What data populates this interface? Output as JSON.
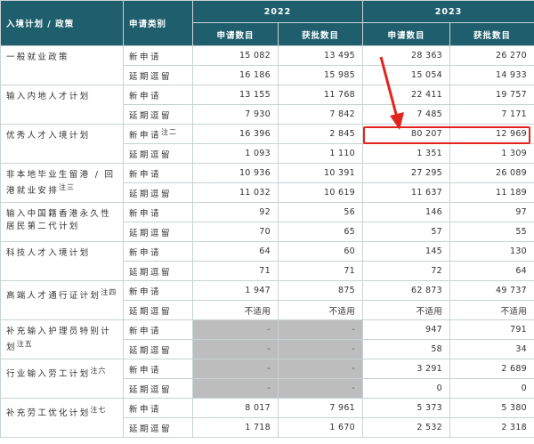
{
  "header": {
    "program": "入境计划 / 政策",
    "type": "申请类别",
    "years": [
      "2022",
      "2023"
    ],
    "cols": [
      "申请数目",
      "获批数目",
      "申请数目",
      "获批数目"
    ]
  },
  "groups": [
    {
      "name": "一般就业政策",
      "note": "",
      "rows": [
        {
          "type": "新申请",
          "v": [
            "15 082",
            "13 495",
            "28 363",
            "26 270"
          ]
        },
        {
          "type": "延期逗留",
          "v": [
            "16 186",
            "15 985",
            "15 054",
            "14 933"
          ]
        }
      ]
    },
    {
      "name": "输入内地人才计划",
      "note": "",
      "rows": [
        {
          "type": "新申请",
          "v": [
            "13 155",
            "11 768",
            "22 411",
            "19 757"
          ]
        },
        {
          "type": "延期逗留",
          "v": [
            "7 930",
            "7 842",
            "7 485",
            "7 171"
          ]
        }
      ]
    },
    {
      "name": "优秀人才入境计划",
      "note": "",
      "rows": [
        {
          "type": "新申请",
          "note": "注二",
          "v": [
            "16 396",
            "2 845",
            "80 207",
            "12 969"
          ]
        },
        {
          "type": "延期逗留",
          "v": [
            "1 093",
            "1 110",
            "1 351",
            "1 309"
          ]
        }
      ]
    },
    {
      "name": "非本地毕业生留港 / 回港就业安排",
      "note": "注三",
      "rows": [
        {
          "type": "新申请",
          "v": [
            "10 936",
            "10 391",
            "27 295",
            "26 089"
          ]
        },
        {
          "type": "延期逗留",
          "v": [
            "11 032",
            "10 619",
            "11 637",
            "11 189"
          ]
        }
      ]
    },
    {
      "name": "输入中国籍香港永久性居民第二代计划",
      "note": "",
      "rows": [
        {
          "type": "新申请",
          "v": [
            "92",
            "56",
            "146",
            "97"
          ]
        },
        {
          "type": "延期逗留",
          "v": [
            "70",
            "65",
            "57",
            "55"
          ]
        }
      ]
    },
    {
      "name": "科技人才入境计划",
      "note": "",
      "rows": [
        {
          "type": "新申请",
          "v": [
            "64",
            "60",
            "145",
            "130"
          ]
        },
        {
          "type": "延期逗留",
          "v": [
            "71",
            "71",
            "72",
            "64"
          ]
        }
      ]
    },
    {
      "name": "高端人才通行证计划",
      "note": "注四",
      "rows": [
        {
          "type": "新申请",
          "v": [
            "1 947",
            "875",
            "62 873",
            "49 737"
          ]
        },
        {
          "type": "延期逗留",
          "v": [
            "不适用",
            "不适用",
            "不适用",
            "不适用"
          ]
        }
      ]
    },
    {
      "name": "补充输入护理员特别计划",
      "note": "注五",
      "rows": [
        {
          "type": "新申请",
          "gray": true,
          "v": [
            "-",
            "-",
            "947",
            "791"
          ]
        },
        {
          "type": "延期逗留",
          "gray": true,
          "v": [
            "-",
            "-",
            "58",
            "34"
          ]
        }
      ]
    },
    {
      "name": "行业输入劳工计划",
      "note": "注六",
      "rows": [
        {
          "type": "新申请",
          "gray": true,
          "v": [
            "-",
            "-",
            "3 291",
            "2 689"
          ]
        },
        {
          "type": "延期逗留",
          "gray": true,
          "v": [
            "-",
            "-",
            "0",
            "0"
          ]
        }
      ]
    },
    {
      "name": "补充劳工优化计划",
      "note": "注七",
      "rows": [
        {
          "type": "新申请",
          "v": [
            "8 017",
            "7 961",
            "5 373",
            "5 380"
          ]
        },
        {
          "type": "延期逗留",
          "v": [
            "1 718",
            "1 670",
            "2 532",
            "2 318"
          ]
        }
      ]
    }
  ],
  "highlight_color": "#e3241c"
}
